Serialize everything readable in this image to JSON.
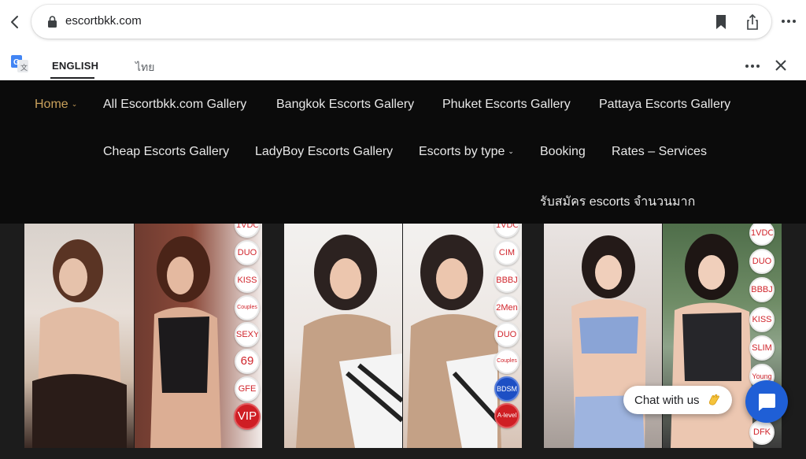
{
  "browser": {
    "url": "escortbkk.com"
  },
  "translate": {
    "tab_english": "ENGLISH",
    "tab_thai": "ไทย"
  },
  "nav": {
    "home": "Home",
    "all_gallery": "All Escortbkk.com Gallery",
    "bangkok": "Bangkok Escorts Gallery",
    "phuket": "Phuket Escorts Gallery",
    "pattaya": "Pattaya Escorts Gallery",
    "cheap": "Cheap Escorts Gallery",
    "ladyboy": "LadyBoy Escorts Gallery",
    "by_type": "Escorts by type",
    "booking": "Booking",
    "rates": "Rates – Services",
    "recruit": "รับสมัคร escorts จำนวนมาก"
  },
  "cards": [
    {
      "badges": [
        "1VDO",
        "DUO",
        "KISS",
        "Couples",
        "SEXY",
        "69",
        "GFE",
        "VIP"
      ]
    },
    {
      "badges": [
        "1VDO",
        "CIM",
        "BBBJ",
        "2Men",
        "DUO",
        "Couples",
        "BDSM",
        "A-level"
      ]
    },
    {
      "badges": [
        "1VDO",
        "DUO",
        "BBBJ",
        "KISS",
        "SLIM",
        "Young",
        "DFK"
      ]
    }
  ],
  "chat": {
    "label": "Chat with us"
  },
  "colors": {
    "nav_bg": "#0b0b0b",
    "nav_active": "#c9a05b",
    "badge_red": "#d0242b",
    "chat_blue": "#1f5fd6"
  }
}
